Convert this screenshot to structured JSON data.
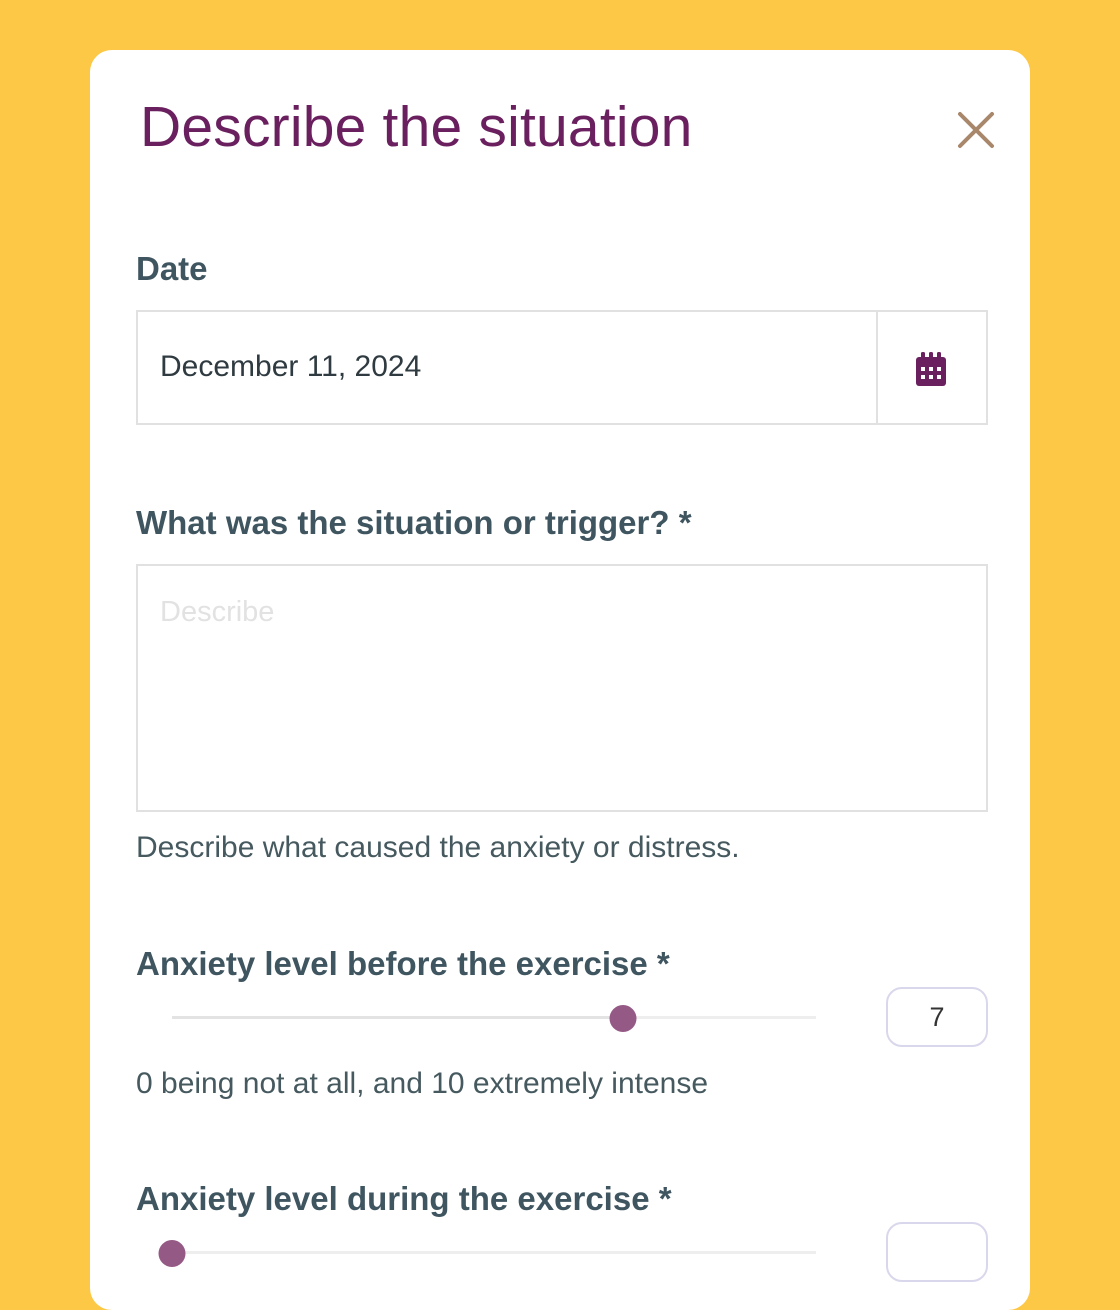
{
  "dialog": {
    "title": "Describe the situation",
    "close_icon": "close-icon",
    "accent_color": "#6a1f5e",
    "background_color": "#fcc845"
  },
  "date": {
    "label": "Date",
    "value": "December 11, 2024",
    "icon": "calendar-icon"
  },
  "situation": {
    "label": "What was the situation or trigger? *",
    "placeholder": "Describe",
    "value": "",
    "help": "Describe what caused the anxiety or distress."
  },
  "anxiety_before": {
    "label": "Anxiety level before the exercise *",
    "value": 7,
    "value_text": "7",
    "min": 0,
    "max": 10,
    "help": "0 being not at all, and 10 extremely intense"
  },
  "anxiety_during": {
    "label": "Anxiety level during the exercise *",
    "value": 0,
    "value_text": "",
    "min": 0,
    "max": 10
  },
  "slider_thumb_color": "#955985"
}
